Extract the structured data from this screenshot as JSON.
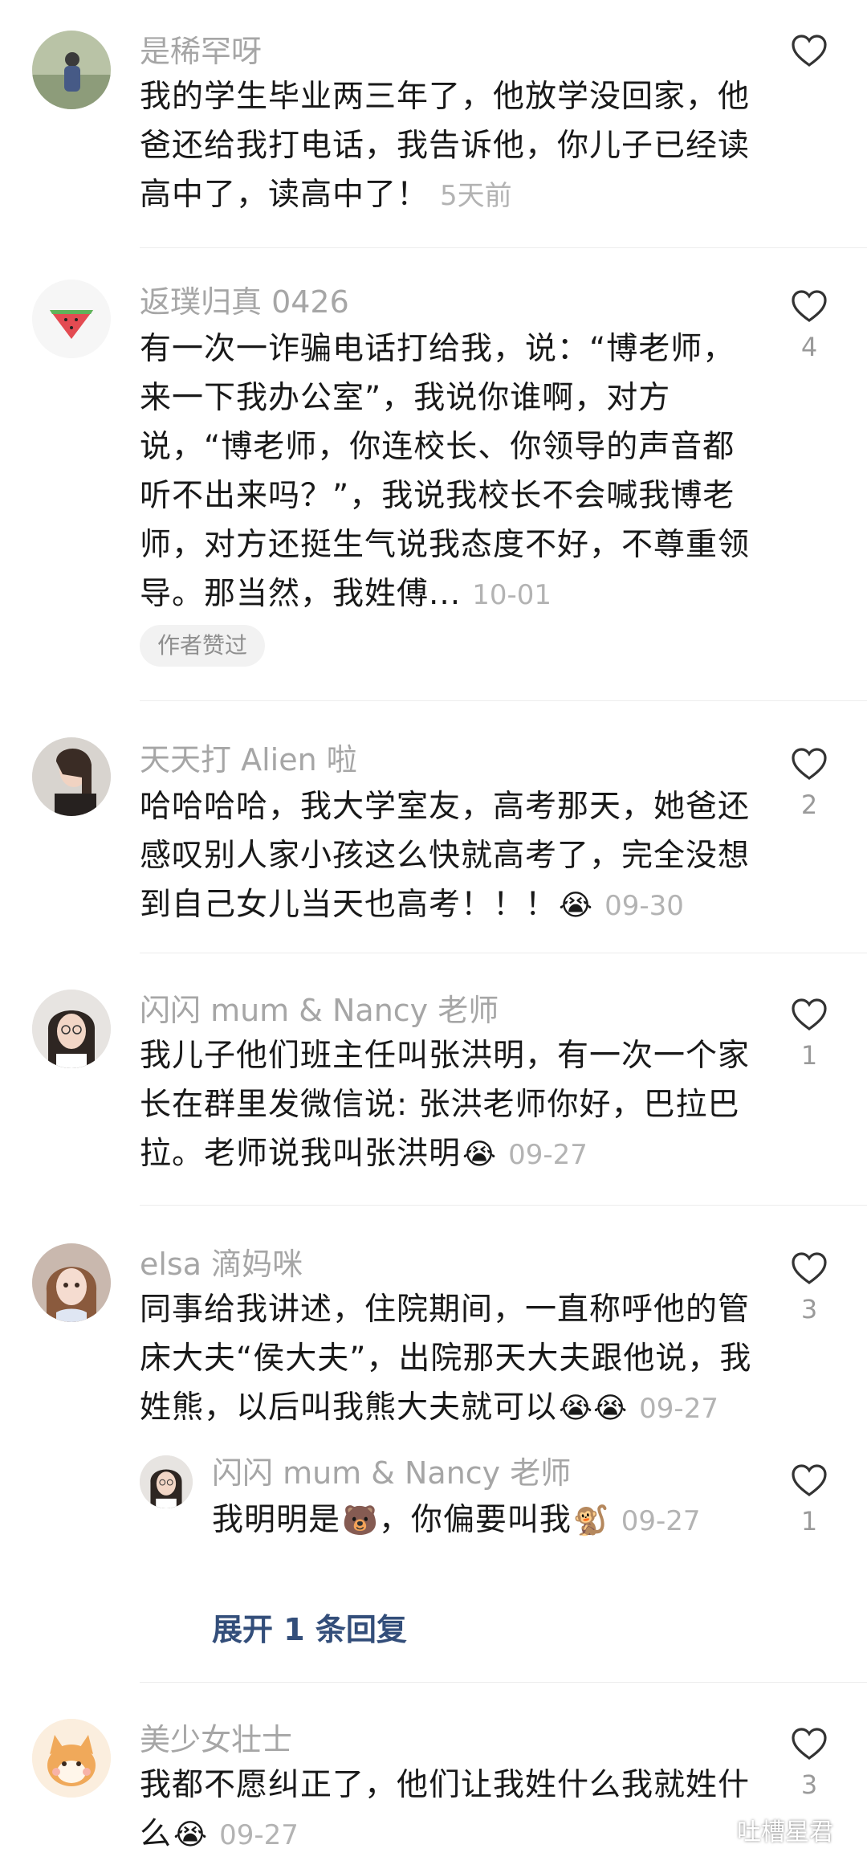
{
  "comments": [
    {
      "username": "是稀罕呀",
      "text": "我的学生毕业两三年了，他放学没回家，他爸还给我打电话，我告诉他，你儿子已经读高中了，读高中了！",
      "time": "5天前",
      "likes": ""
    },
    {
      "username": "返璞归真 0426",
      "text": "有一次一诈骗电话打给我，说：“博老师，来一下我办公室”，我说你谁啊，对方说，“博老师，你连校长、你领导的声音都听不出来吗？”，我说我校长不会喊我博老师，对方还挺生气说我态度不好，不尊重领导。那当然，我姓傅...",
      "time": "10-01",
      "likes": "4",
      "badge": "作者赞过"
    },
    {
      "username": "天天打 Alien 啦",
      "text": "哈哈哈哈，我大学室友，高考那天，她爸还感叹别人家小孩这么快就高考了，完全没想到自己女儿当天也高考！！！",
      "emoji": "😭",
      "time": "09-30",
      "likes": "2"
    },
    {
      "username": "闪闪 mum & Nancy 老师",
      "text": "我儿子他们班主任叫张洪明，有一次一个家长在群里发微信说: 张洪老师你好，巴拉巴拉。老师说我叫张洪明",
      "emoji": "😭",
      "time": "09-27",
      "likes": "1"
    },
    {
      "username": "elsa 滴妈咪",
      "text": "同事给我讲述，住院期间，一直称呼他的管床大夫“侯大夫”，出院那天大夫跟他说，我姓熊，以后叫我熊大夫就可以",
      "emoji": "😭😭",
      "time": "09-27",
      "likes": "3",
      "reply": {
        "username": "闪闪 mum & Nancy 老师",
        "text_a": "我明明是",
        "emoji_a": "🐻",
        "text_b": "，你偏要叫我",
        "emoji_b": "🐒",
        "time": "09-27",
        "likes": "1"
      },
      "expand_label": "展开 1 条回复"
    },
    {
      "username": "美少女壮士",
      "text": "我都不愿纠正了，他们让我姓什么我就姓什么",
      "emoji": "😭",
      "time": "09-27",
      "likes": "3"
    }
  ],
  "watermark": "吐槽星君",
  "colors": {
    "username": "#a6a6a6",
    "body_text": "#191919",
    "timestamp": "#b3b3b3",
    "expand_link": "#334e7a",
    "divider": "#ececec"
  },
  "icons": {
    "like": "heart-outline-icon",
    "watermark": "wechat-icon"
  }
}
